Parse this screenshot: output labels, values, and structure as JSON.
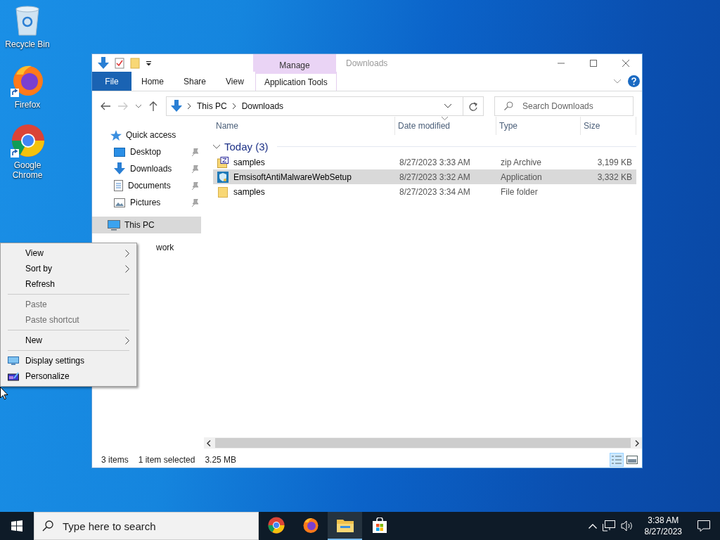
{
  "desktop_icons": [
    {
      "label": "Recycle Bin",
      "kind": "recycle",
      "shortcut": false
    },
    {
      "label": "Firefox",
      "kind": "firefox",
      "shortcut": true
    },
    {
      "label": "Google Chrome",
      "kind": "chrome",
      "shortcut": true
    }
  ],
  "explorer": {
    "title": "Downloads",
    "contextual": {
      "group": "Manage",
      "tab": "Application Tools"
    },
    "ribbon_tabs": [
      {
        "label": "File",
        "kind": "file"
      },
      {
        "label": "Home",
        "kind": "tab"
      },
      {
        "label": "Share",
        "kind": "tab"
      },
      {
        "label": "View",
        "kind": "tab"
      }
    ],
    "address": [
      "This PC",
      "Downloads"
    ],
    "search": {
      "placeholder": "Search Downloads"
    },
    "nav": [
      {
        "label": "Quick access",
        "kind": "star",
        "selected": false,
        "children": [
          {
            "label": "Desktop",
            "kind": "desktop",
            "pinned": true
          },
          {
            "label": "Downloads",
            "kind": "download",
            "pinned": true
          },
          {
            "label": "Documents",
            "kind": "document",
            "pinned": true
          },
          {
            "label": "Pictures",
            "kind": "pictures",
            "pinned": true
          }
        ]
      },
      {
        "label": "This PC",
        "kind": "pc",
        "selected": true
      },
      {
        "label": "work",
        "kind": "none",
        "selected": false
      }
    ],
    "columns": [
      {
        "label": "Name",
        "sorted": false
      },
      {
        "label": "Date modified",
        "sorted": true
      },
      {
        "label": "Type",
        "sorted": false
      },
      {
        "label": "Size",
        "sorted": false
      }
    ],
    "group": {
      "label": "Today (3)",
      "expanded": true
    },
    "files": [
      {
        "name": "samples",
        "date": "8/27/2023 3:33 AM",
        "type": "zip Archive",
        "size": "3,199 KB",
        "kind": "zip",
        "selected": false
      },
      {
        "name": "EmsisoftAntiMalwareWebSetup",
        "date": "8/27/2023 3:32 AM",
        "type": "Application",
        "size": "3,332 KB",
        "kind": "app",
        "selected": true
      },
      {
        "name": "samples",
        "date": "8/27/2023 3:34 AM",
        "type": "File folder",
        "kind": "folder",
        "selected": false
      }
    ],
    "status": {
      "count": "3 items",
      "selection": "1 item selected",
      "size": "3.25 MB"
    }
  },
  "context_menu": [
    {
      "label": "View",
      "kind": "submenu",
      "disabled": false
    },
    {
      "label": "Sort by",
      "kind": "submenu",
      "disabled": false
    },
    {
      "label": "Refresh",
      "kind": "item",
      "disabled": false
    },
    {
      "kind": "separator"
    },
    {
      "label": "Paste",
      "kind": "item",
      "disabled": true
    },
    {
      "label": "Paste shortcut",
      "kind": "item",
      "disabled": true
    },
    {
      "kind": "separator"
    },
    {
      "label": "New",
      "kind": "submenu",
      "disabled": false
    },
    {
      "kind": "separator"
    },
    {
      "label": "Display settings",
      "kind": "display",
      "disabled": false
    },
    {
      "label": "Personalize",
      "kind": "personalize",
      "disabled": false
    }
  ],
  "taskbar": {
    "search": {
      "placeholder": "Type here to search"
    },
    "apps": [
      {
        "kind": "chrome",
        "running": false
      },
      {
        "kind": "firefox",
        "running": false
      },
      {
        "kind": "explorer",
        "running": true
      },
      {
        "kind": "store",
        "running": false
      }
    ],
    "time": "3:38 AM",
    "date": "8/27/2023"
  }
}
